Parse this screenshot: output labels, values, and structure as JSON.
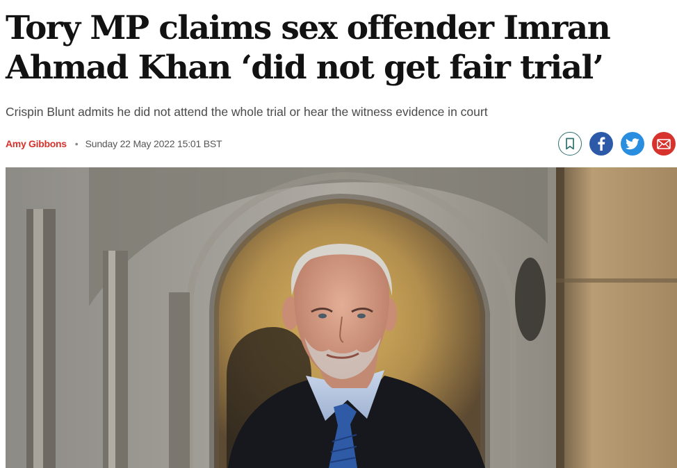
{
  "article": {
    "headline": "Tory MP claims sex offender Imran Ahmad Khan ‘did not get fair trial’",
    "standfirst": "Crispin Blunt admits he did not attend the whole trial or hear the witness evidence in court",
    "author": "Amy Gibbons",
    "separator": "•",
    "date": "Sunday 22 May 2022 15:01 BST"
  },
  "share": {
    "icons": [
      "bookmark-icon",
      "facebook-icon",
      "twitter-icon",
      "email-icon"
    ],
    "colors": {
      "bookmark_border": "#2f6f6f",
      "facebook": "#2c5aa8",
      "twitter": "#2a8ee0",
      "email": "#d7322c"
    }
  },
  "theme": {
    "author_color": "#d7322c",
    "headline_color": "#121212",
    "standfirst_color": "#4a4a4a"
  }
}
